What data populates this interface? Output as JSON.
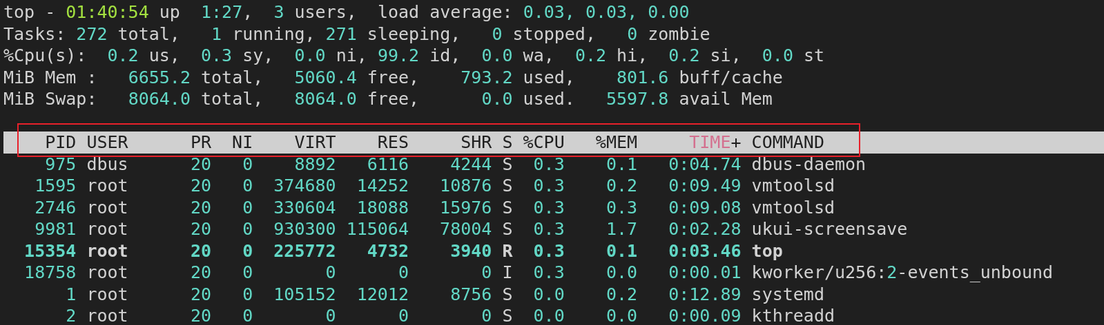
{
  "summary": [
    [
      {
        "text": "top - ",
        "kind": "text"
      },
      {
        "text": "01:40:54",
        "kind": "clock"
      },
      {
        "text": " up  ",
        "kind": "text"
      },
      {
        "text": "1:27",
        "kind": "value"
      },
      {
        "text": ",  ",
        "kind": "text"
      },
      {
        "text": "3",
        "kind": "value"
      },
      {
        "text": " users,  load average: ",
        "kind": "text"
      },
      {
        "text": "0.03, 0.03, 0.00",
        "kind": "value"
      }
    ],
    [
      {
        "text": "Tasks: ",
        "kind": "text"
      },
      {
        "text": "272",
        "kind": "value"
      },
      {
        "text": " total,   ",
        "kind": "text"
      },
      {
        "text": "1",
        "kind": "value"
      },
      {
        "text": " running, ",
        "kind": "text"
      },
      {
        "text": "271",
        "kind": "value"
      },
      {
        "text": " sleeping,   ",
        "kind": "text"
      },
      {
        "text": "0",
        "kind": "value"
      },
      {
        "text": " stopped,   ",
        "kind": "text"
      },
      {
        "text": "0",
        "kind": "value"
      },
      {
        "text": " zombie",
        "kind": "text"
      }
    ],
    [
      {
        "text": "%Cpu(s):  ",
        "kind": "text"
      },
      {
        "text": "0.2",
        "kind": "value"
      },
      {
        "text": " us,  ",
        "kind": "text"
      },
      {
        "text": "0.3",
        "kind": "value"
      },
      {
        "text": " sy,  ",
        "kind": "text"
      },
      {
        "text": "0.0",
        "kind": "value"
      },
      {
        "text": " ni, ",
        "kind": "text"
      },
      {
        "text": "99.2",
        "kind": "value"
      },
      {
        "text": " id,  ",
        "kind": "text"
      },
      {
        "text": "0.0",
        "kind": "value"
      },
      {
        "text": " wa,  ",
        "kind": "text"
      },
      {
        "text": "0.2",
        "kind": "value"
      },
      {
        "text": " hi,  ",
        "kind": "text"
      },
      {
        "text": "0.2",
        "kind": "value"
      },
      {
        "text": " si,  ",
        "kind": "text"
      },
      {
        "text": "0.0",
        "kind": "value"
      },
      {
        "text": " st",
        "kind": "text"
      }
    ],
    [
      {
        "text": "MiB Mem :   ",
        "kind": "text"
      },
      {
        "text": "6655.2",
        "kind": "value"
      },
      {
        "text": " total,   ",
        "kind": "text"
      },
      {
        "text": "5060.4",
        "kind": "value"
      },
      {
        "text": " free,    ",
        "kind": "text"
      },
      {
        "text": "793.2",
        "kind": "value"
      },
      {
        "text": " used,    ",
        "kind": "text"
      },
      {
        "text": "801.6",
        "kind": "value"
      },
      {
        "text": " buff/cache",
        "kind": "text"
      }
    ],
    [
      {
        "text": "MiB Swap:   ",
        "kind": "text"
      },
      {
        "text": "8064.0",
        "kind": "value"
      },
      {
        "text": " total,   ",
        "kind": "text"
      },
      {
        "text": "8064.0",
        "kind": "value"
      },
      {
        "text": " free,      ",
        "kind": "text"
      },
      {
        "text": "0.0",
        "kind": "value"
      },
      {
        "text": " used.   ",
        "kind": "text"
      },
      {
        "text": "5597.8",
        "kind": "value"
      },
      {
        "text": " avail Mem",
        "kind": "text"
      }
    ]
  ],
  "table": {
    "header_outlined": true,
    "columns": [
      {
        "label": "PID",
        "kind": "numeric",
        "sorted": false
      },
      {
        "label": "USER",
        "kind": "text",
        "sorted": false
      },
      {
        "label": "PR",
        "kind": "numeric",
        "sorted": false
      },
      {
        "label": "NI",
        "kind": "numeric",
        "sorted": false
      },
      {
        "label": "VIRT",
        "kind": "numeric",
        "sorted": false
      },
      {
        "label": "RES",
        "kind": "numeric",
        "sorted": false
      },
      {
        "label": "SHR",
        "kind": "numeric",
        "sorted": false
      },
      {
        "label": "S",
        "kind": "text",
        "sorted": false
      },
      {
        "label": "%CPU",
        "kind": "numeric",
        "sorted": false
      },
      {
        "label": "%MEM",
        "kind": "numeric",
        "sorted": false
      },
      {
        "label": "TIME+",
        "kind": "numeric",
        "sorted": true
      },
      {
        "label": "COMMAND",
        "kind": "text",
        "sorted": false
      }
    ],
    "rows": [
      {
        "bold": false,
        "cells": [
          "975",
          "dbus",
          "20",
          "0",
          "8892",
          "6116",
          "4244",
          "S",
          "0.3",
          "0.1",
          "0:04.74"
        ],
        "command": [
          {
            "text": "dbus-daemon",
            "kind": "text"
          }
        ]
      },
      {
        "bold": false,
        "cells": [
          "1595",
          "root",
          "20",
          "0",
          "374680",
          "14252",
          "10876",
          "S",
          "0.3",
          "0.2",
          "0:09.49"
        ],
        "command": [
          {
            "text": "vmtoolsd",
            "kind": "text"
          }
        ]
      },
      {
        "bold": false,
        "cells": [
          "2746",
          "root",
          "20",
          "0",
          "330604",
          "18088",
          "15976",
          "S",
          "0.3",
          "0.3",
          "0:09.08"
        ],
        "command": [
          {
            "text": "vmtoolsd",
            "kind": "text"
          }
        ]
      },
      {
        "bold": false,
        "cells": [
          "9981",
          "root",
          "20",
          "0",
          "930300",
          "115064",
          "78004",
          "S",
          "0.3",
          "1.7",
          "0:02.28"
        ],
        "command": [
          {
            "text": "ukui-screensave",
            "kind": "text"
          }
        ]
      },
      {
        "bold": true,
        "cells": [
          "15354",
          "root",
          "20",
          "0",
          "225772",
          "4732",
          "3940",
          "R",
          "0.3",
          "0.1",
          "0:03.46"
        ],
        "command": [
          {
            "text": "top",
            "kind": "text"
          }
        ]
      },
      {
        "bold": false,
        "cells": [
          "18758",
          "root",
          "20",
          "0",
          "0",
          "0",
          "0",
          "I",
          "0.3",
          "0.0",
          "0:00.01"
        ],
        "command": [
          {
            "text": "kworker/u256:",
            "kind": "text"
          },
          {
            "text": "2",
            "kind": "value"
          },
          {
            "text": "-events_unbound",
            "kind": "text"
          }
        ]
      },
      {
        "bold": false,
        "cells": [
          "1",
          "root",
          "20",
          "0",
          "105152",
          "12012",
          "8756",
          "S",
          "0.0",
          "0.2",
          "0:12.89"
        ],
        "command": [
          {
            "text": "systemd",
            "kind": "text"
          }
        ]
      },
      {
        "bold": false,
        "cells": [
          "2",
          "root",
          "20",
          "0",
          "0",
          "0",
          "0",
          "S",
          "0.0",
          "0.0",
          "0:00.09"
        ],
        "command": [
          {
            "text": "kthreadd",
            "kind": "text"
          }
        ]
      }
    ]
  }
}
